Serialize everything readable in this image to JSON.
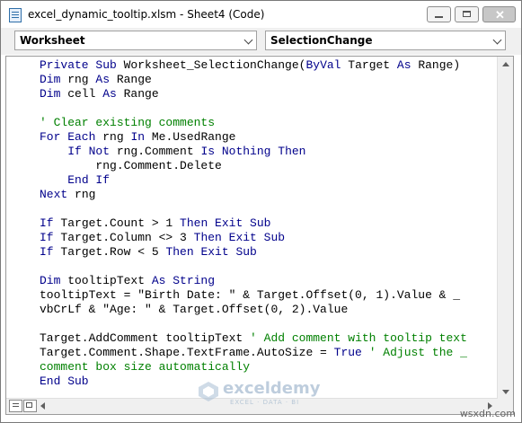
{
  "window": {
    "title": "excel_dynamic_tooltip.xlsm - Sheet4 (Code)"
  },
  "toolbar": {
    "object_dropdown": "Worksheet",
    "procedure_dropdown": "SelectionChange"
  },
  "code_lines": [
    [
      {
        "t": "Private Sub ",
        "c": "kw"
      },
      {
        "t": "Worksheet_SelectionChange(",
        "c": ""
      },
      {
        "t": "ByVal",
        "c": "kw"
      },
      {
        "t": " Target ",
        "c": ""
      },
      {
        "t": "As",
        "c": "kw"
      },
      {
        "t": " Range)",
        "c": ""
      }
    ],
    [
      {
        "t": "Dim",
        "c": "kw"
      },
      {
        "t": " rng ",
        "c": ""
      },
      {
        "t": "As",
        "c": "kw"
      },
      {
        "t": " Range",
        "c": ""
      }
    ],
    [
      {
        "t": "Dim",
        "c": "kw"
      },
      {
        "t": " cell ",
        "c": ""
      },
      {
        "t": "As",
        "c": "kw"
      },
      {
        "t": " Range",
        "c": ""
      }
    ],
    [],
    [
      {
        "t": "' Clear existing comments",
        "c": "cm"
      }
    ],
    [
      {
        "t": "For Each",
        "c": "kw"
      },
      {
        "t": " rng ",
        "c": ""
      },
      {
        "t": "In",
        "c": "kw"
      },
      {
        "t": " Me.UsedRange",
        "c": ""
      }
    ],
    [
      {
        "t": "    ",
        "c": ""
      },
      {
        "t": "If Not",
        "c": "kw"
      },
      {
        "t": " rng.Comment ",
        "c": ""
      },
      {
        "t": "Is Nothing Then",
        "c": "kw"
      }
    ],
    [
      {
        "t": "        rng.Comment.Delete",
        "c": ""
      }
    ],
    [
      {
        "t": "    ",
        "c": ""
      },
      {
        "t": "End If",
        "c": "kw"
      }
    ],
    [
      {
        "t": "Next",
        "c": "kw"
      },
      {
        "t": " rng",
        "c": ""
      }
    ],
    [],
    [
      {
        "t": "If",
        "c": "kw"
      },
      {
        "t": " Target.Count > 1 ",
        "c": ""
      },
      {
        "t": "Then Exit Sub",
        "c": "kw"
      }
    ],
    [
      {
        "t": "If",
        "c": "kw"
      },
      {
        "t": " Target.Column <> 3 ",
        "c": ""
      },
      {
        "t": "Then Exit Sub",
        "c": "kw"
      }
    ],
    [
      {
        "t": "If",
        "c": "kw"
      },
      {
        "t": " Target.Row < 5 ",
        "c": ""
      },
      {
        "t": "Then Exit Sub",
        "c": "kw"
      }
    ],
    [],
    [
      {
        "t": "Dim",
        "c": "kw"
      },
      {
        "t": " tooltipText ",
        "c": ""
      },
      {
        "t": "As String",
        "c": "kw"
      }
    ],
    [
      {
        "t": "tooltipText = \"Birth Date: \" & Target.Offset(0, 1).Value & _",
        "c": ""
      }
    ],
    [
      {
        "t": "vbCrLf & \"Age: \" & Target.Offset(0, 2).Value",
        "c": ""
      }
    ],
    [],
    [
      {
        "t": "Target.AddComment tooltipText ",
        "c": ""
      },
      {
        "t": "' Add comment with tooltip text",
        "c": "cm"
      }
    ],
    [
      {
        "t": "Target.Comment.Shape.TextFrame.AutoSize = ",
        "c": ""
      },
      {
        "t": "True",
        "c": "kw"
      },
      {
        "t": " ",
        "c": ""
      },
      {
        "t": "' Adjust the _",
        "c": "cm"
      }
    ],
    [
      {
        "t": "comment box size automatically",
        "c": "cm"
      }
    ],
    [
      {
        "t": "End Sub",
        "c": "kw"
      }
    ]
  ],
  "watermark": {
    "name": "exceldemy",
    "tagline": "EXCEL · DATA · BI"
  },
  "site_label": "wsxdn.com",
  "icons": {
    "app": "vba-module-icon",
    "minimize": "minimize-icon",
    "maximize": "maximize-icon",
    "close": "close-icon",
    "dropdown": "chevron-down-icon"
  },
  "colors": {
    "keyword": "#00008b",
    "comment": "#008000",
    "text": "#000000"
  }
}
